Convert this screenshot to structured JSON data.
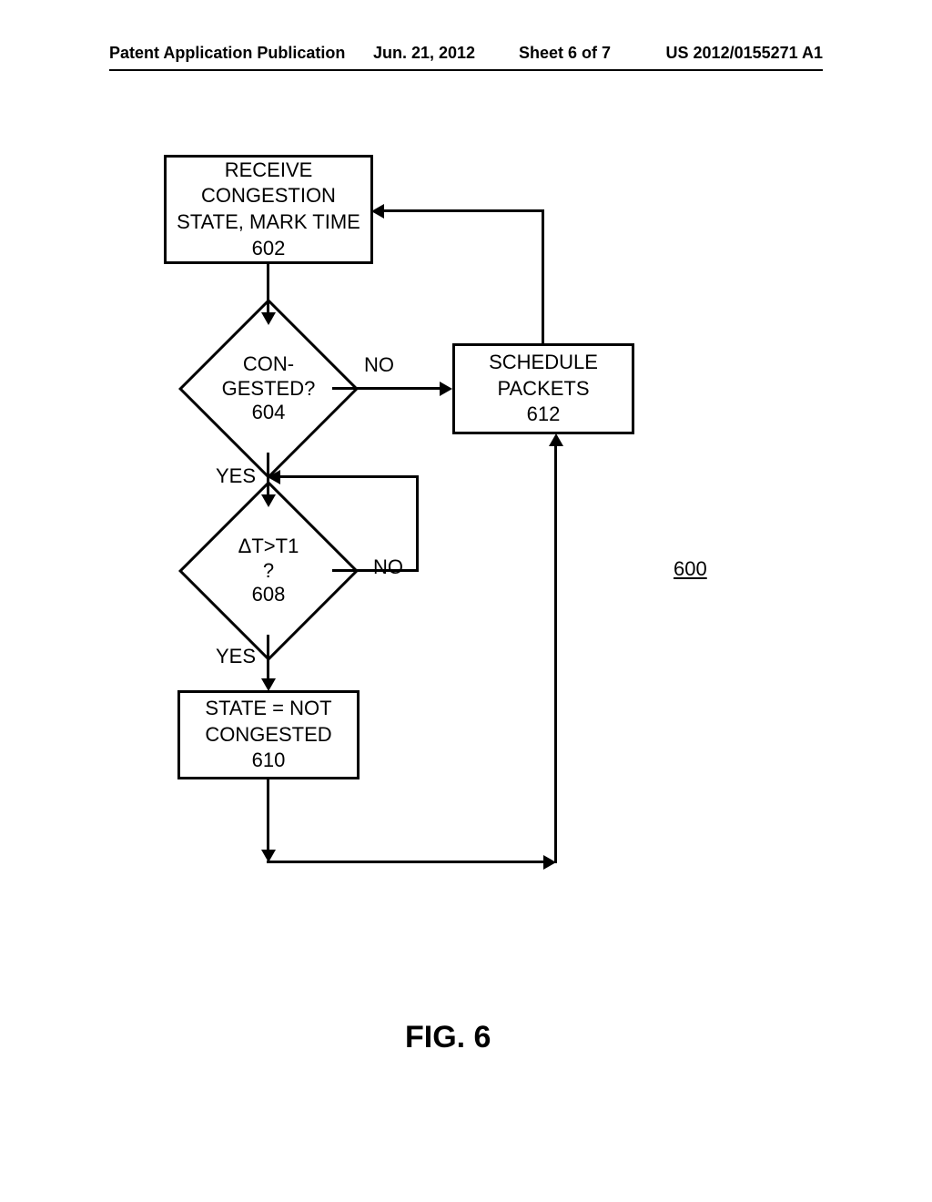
{
  "header": {
    "left": "Patent Application Publication",
    "date": "Jun. 21, 2012",
    "sheet": "Sheet 6 of 7",
    "pubno": "US 2012/0155271 A1"
  },
  "nodes": {
    "n602": {
      "line1": "RECEIVE",
      "line2": "CONGESTION",
      "line3": "STATE, MARK TIME",
      "ref": "602"
    },
    "n604": {
      "line1": "CON-",
      "line2": "GESTED?",
      "ref": "604"
    },
    "n608": {
      "line1": "ΔT>T1",
      "line2": "?",
      "ref": "608"
    },
    "n610": {
      "line1": "STATE = NOT",
      "line2": "CONGESTED",
      "ref": "610"
    },
    "n612": {
      "line1": "SCHEDULE",
      "line2": "PACKETS",
      "ref": "612"
    }
  },
  "labels": {
    "no": "NO",
    "yes": "YES",
    "figref": "600",
    "figcap": "FIG. 6"
  }
}
